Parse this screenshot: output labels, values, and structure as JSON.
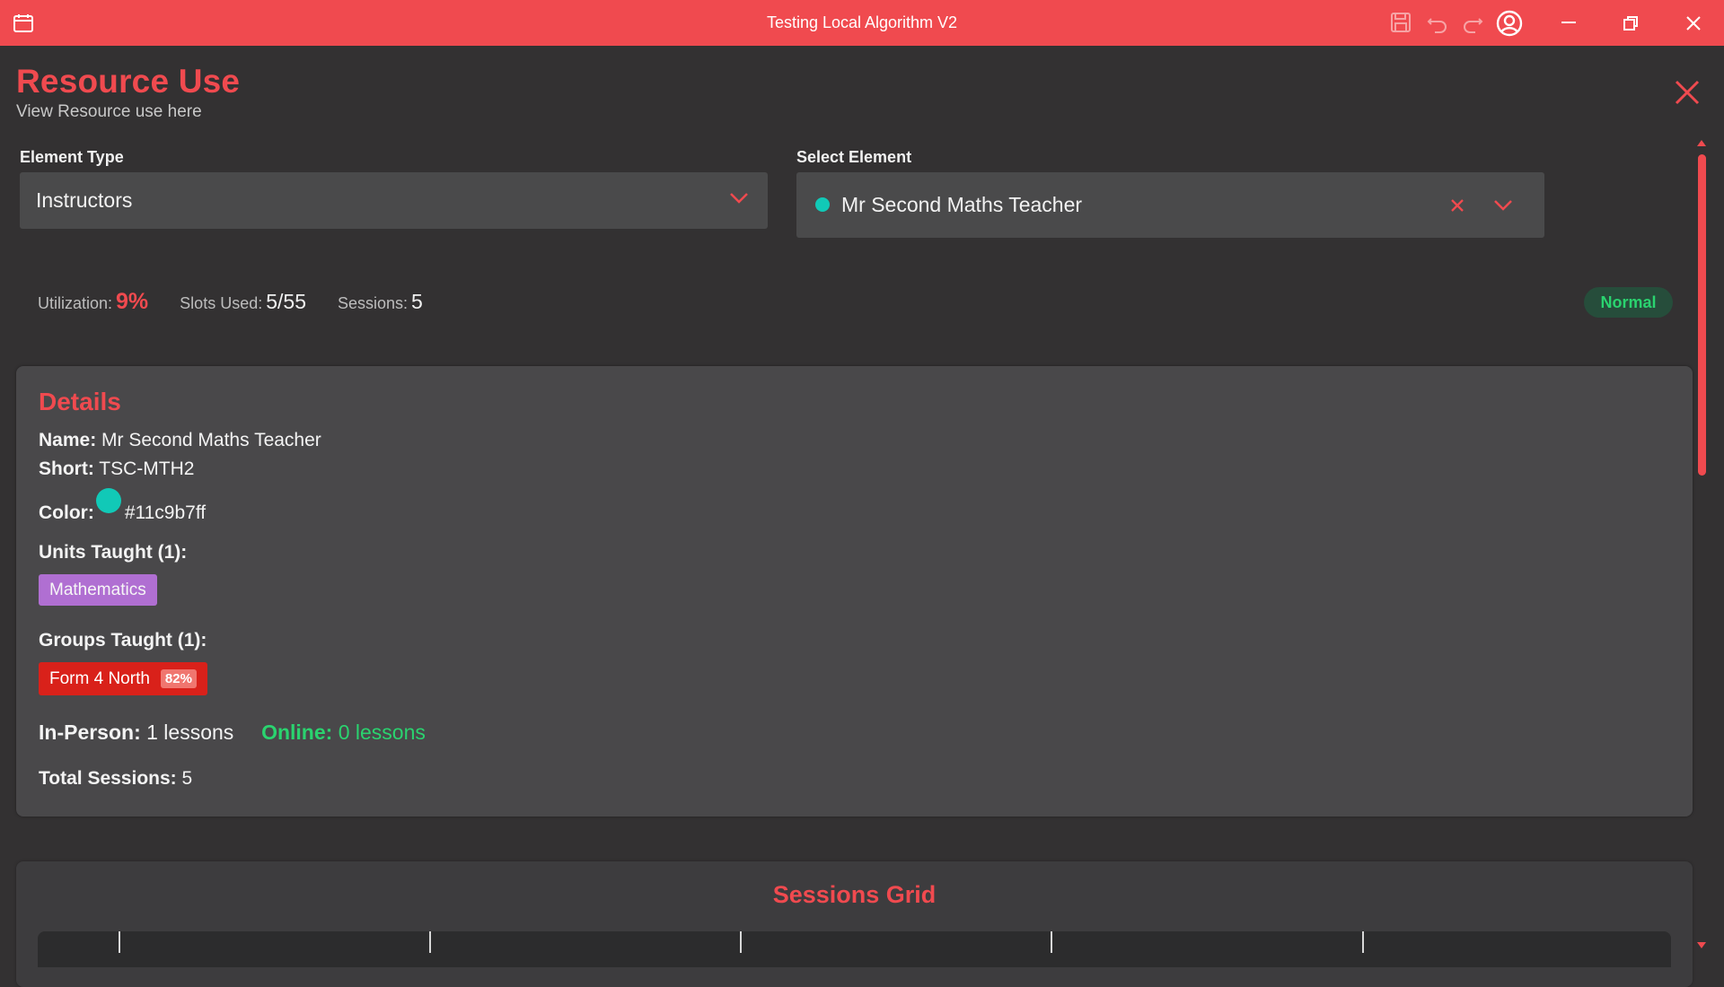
{
  "window": {
    "title": "Testing Local Algorithm V2",
    "icons": [
      "calendar-icon",
      "save-icon",
      "undo-icon",
      "redo-icon",
      "account-icon",
      "minimize-icon",
      "restore-icon",
      "close-icon"
    ]
  },
  "header": {
    "title": "Resource Use",
    "subtitle": "View Resource use here"
  },
  "filters": {
    "element_type_label": "Element Type",
    "element_type_value": "Instructors",
    "select_element_label": "Select Element",
    "select_element_value": "Mr Second Maths Teacher",
    "select_element_color": "#11c9b7"
  },
  "stats": {
    "utilization_label": "Utilization:",
    "utilization_value": "9%",
    "slots_label": "Slots Used:",
    "slots_value": "5/55",
    "sessions_label": "Sessions:",
    "sessions_value": "5",
    "status_badge": "Normal"
  },
  "details": {
    "heading": "Details",
    "name_label": "Name:",
    "name_value": "Mr Second Maths Teacher",
    "short_label": "Short:",
    "short_value": "TSC-MTH2",
    "color_label": "Color:",
    "color_value": "#11c9b7ff",
    "units_label": "Units Taught (1):",
    "units": [
      "Mathematics"
    ],
    "groups_label": "Groups Taught (1):",
    "groups": [
      {
        "name": "Form 4 North",
        "pct": "82%"
      }
    ],
    "inperson_label": "In-Person:",
    "inperson_value": "1 lessons",
    "online_label": "Online:",
    "online_value": "0 lessons",
    "total_label": "Total Sessions:",
    "total_value": "5"
  },
  "sessions_grid": {
    "heading": "Sessions Grid"
  },
  "colors": {
    "accent": "#f04a4f",
    "background": "#333132",
    "card": "#49484a",
    "teal": "#11c9b7",
    "green": "#2ad36f",
    "purple_tag": "#b06fd2",
    "red_tag": "#d9211a"
  }
}
